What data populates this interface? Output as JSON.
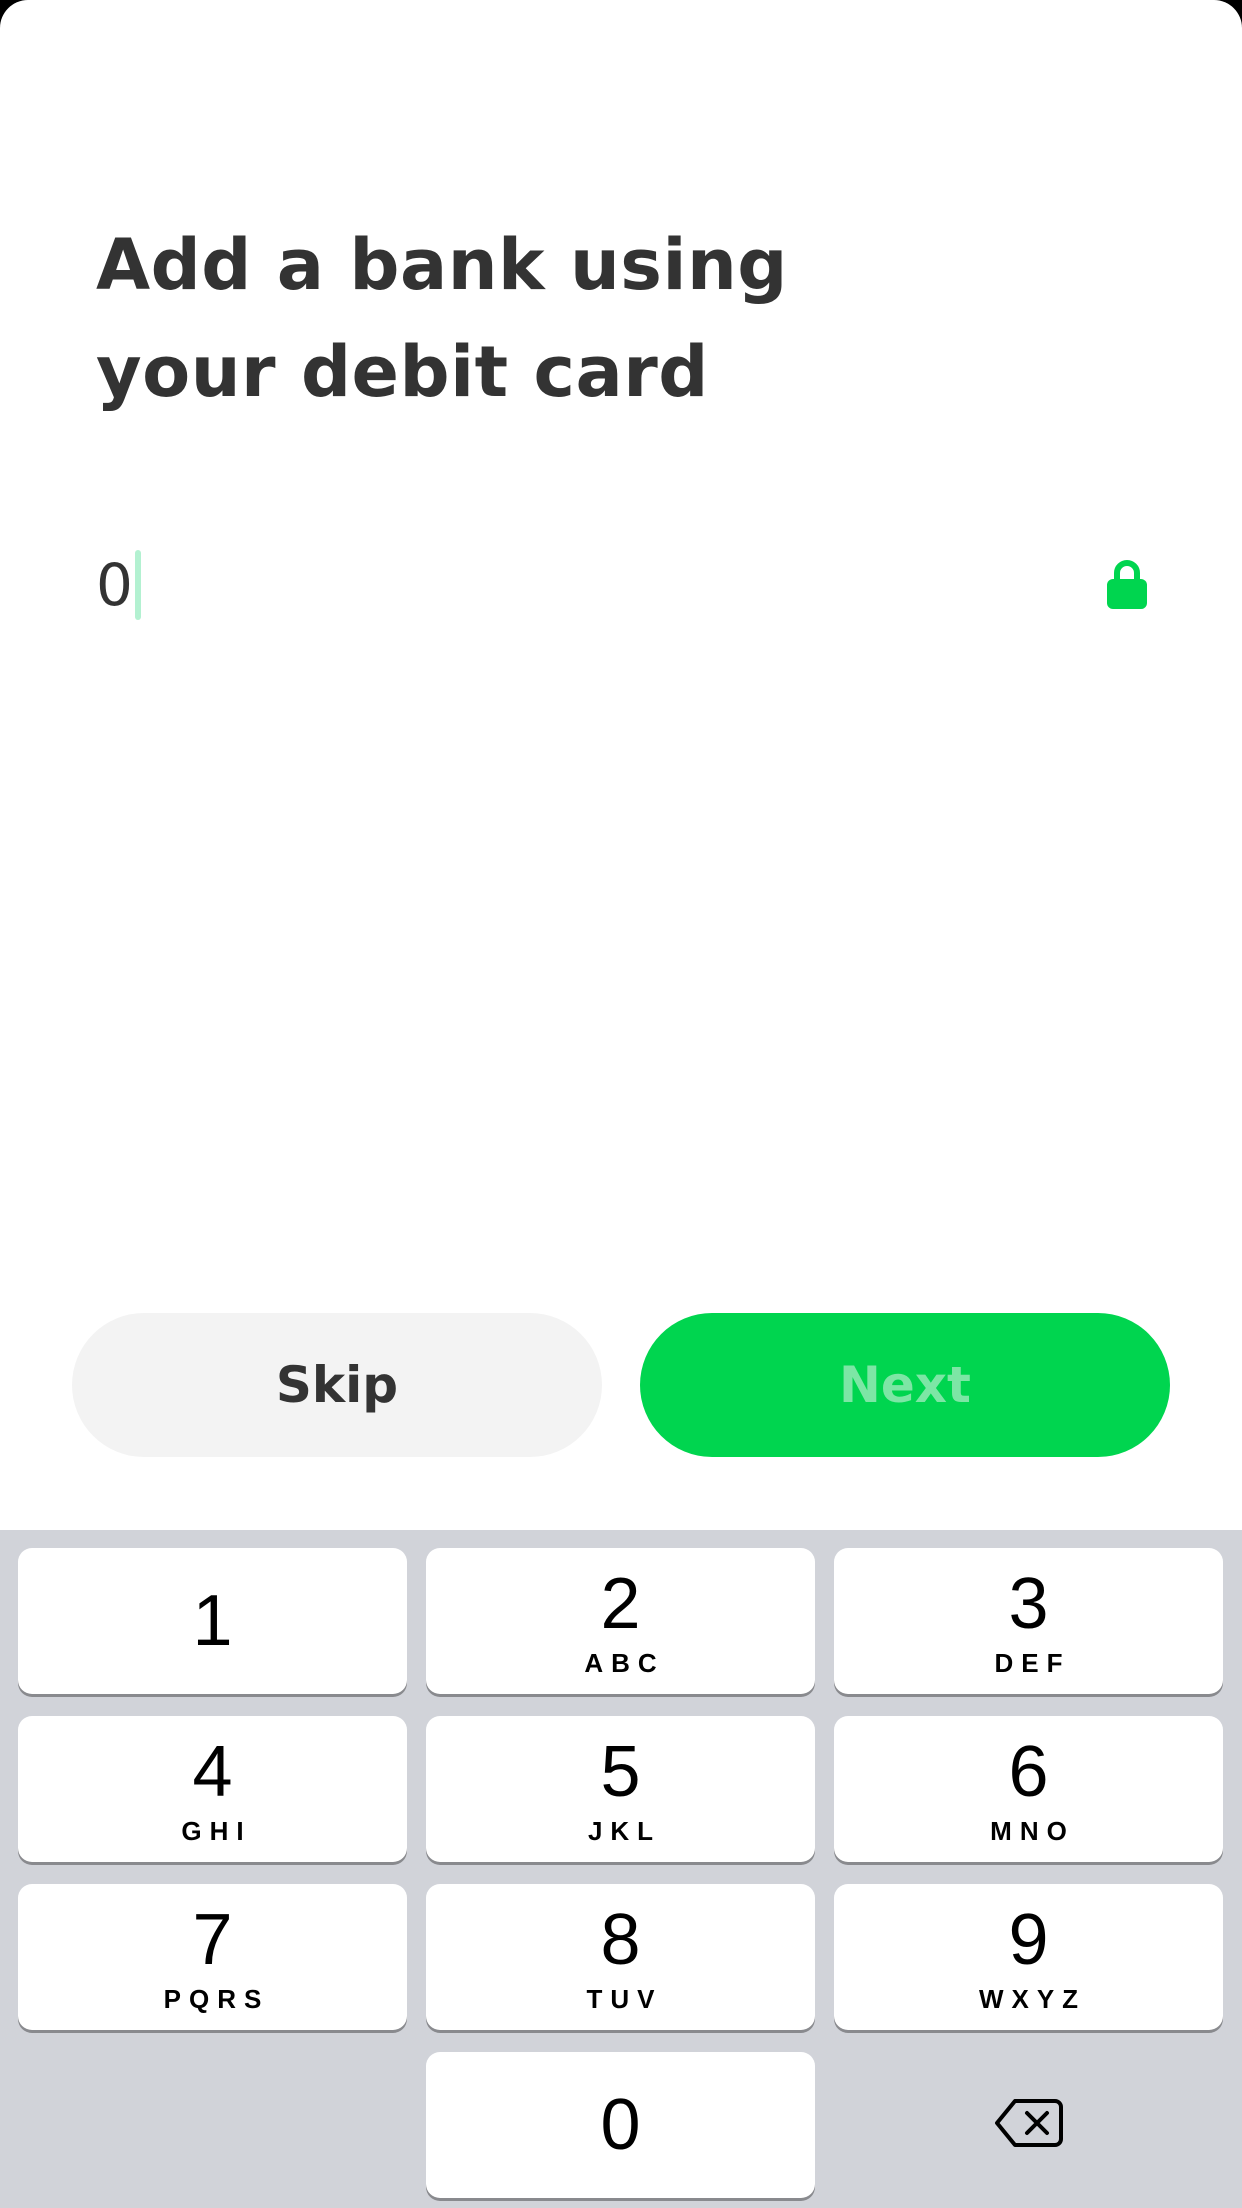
{
  "screen": {
    "title": "Add a bank using your debit card",
    "title_lines": [
      "Add a bank using",
      "your debit card"
    ]
  },
  "card_field": {
    "value": "0",
    "lock_icon": "lock-icon",
    "lock_color": "#00d54f"
  },
  "actions": {
    "skip_label": "Skip",
    "next_label": "Next",
    "next_enabled": false,
    "accent_color": "#00d54f"
  },
  "keypad": {
    "keys": [
      {
        "digit": "1",
        "letters": ""
      },
      {
        "digit": "2",
        "letters": "ABC"
      },
      {
        "digit": "3",
        "letters": "DEF"
      },
      {
        "digit": "4",
        "letters": "GHI"
      },
      {
        "digit": "5",
        "letters": "JKL"
      },
      {
        "digit": "6",
        "letters": "MNO"
      },
      {
        "digit": "7",
        "letters": "PQRS"
      },
      {
        "digit": "8",
        "letters": "TUV"
      },
      {
        "digit": "9",
        "letters": "WXYZ"
      },
      {
        "digit": "0",
        "letters": ""
      }
    ],
    "delete_icon": "backspace-icon"
  }
}
